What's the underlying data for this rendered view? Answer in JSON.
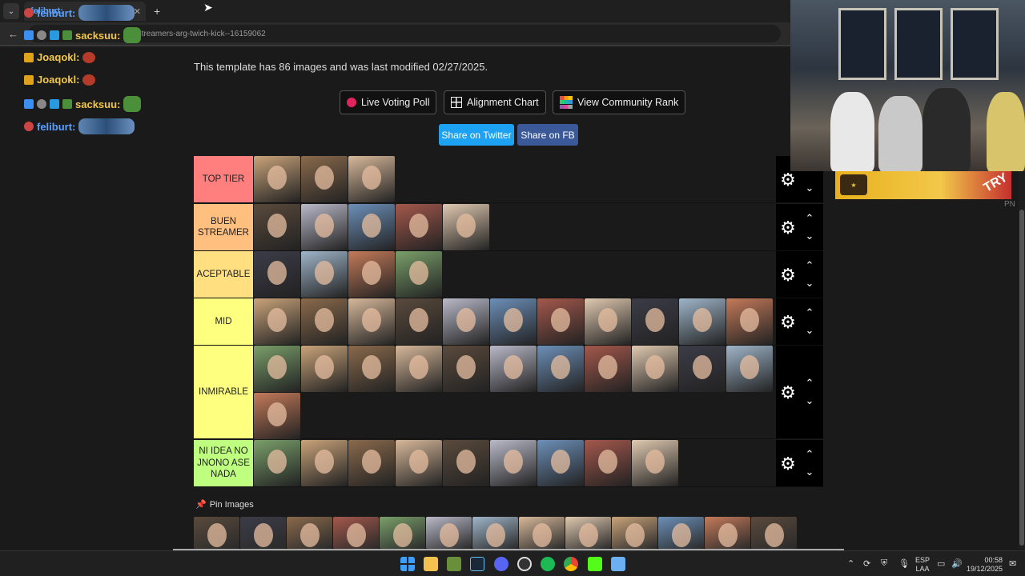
{
  "browser": {
    "tab_title": "feliburt:",
    "tab_close": "✕",
    "new_tab": "+",
    "url": "ate/streamers-arg-twich-kick--16159062",
    "back": "←"
  },
  "chat": [
    {
      "user": "feliburt:",
      "color": "#5aa0ff"
    },
    {
      "user": "sacksuu:",
      "color": "#f2c84a"
    },
    {
      "user": "Joaqokl:",
      "color": "#f2c84a"
    },
    {
      "user": "Joaqokl:",
      "color": "#f2c84a"
    },
    {
      "user": "sacksuu:",
      "color": "#f2c84a"
    },
    {
      "user": "feliburt:",
      "color": "#5aa0ff"
    }
  ],
  "page": {
    "info": "This template has 86 images and was last modified 02/27/2025.",
    "buttons": {
      "live_voting": "Live Voting Poll",
      "alignment": "Alignment Chart",
      "community": "View Community Rank",
      "share_twitter": "Share on Twitter",
      "share_fb": "Share on FB"
    },
    "pin_images": "Pin Images"
  },
  "tiers": [
    {
      "label": "TOP TIER",
      "color": "#ff7f7f",
      "count": 3
    },
    {
      "label": "BUEN STREAMER",
      "color": "#ffbf7f",
      "count": 5
    },
    {
      "label": "ACEPTABLE",
      "color": "#ffdf7f",
      "count": 4
    },
    {
      "label": "MID",
      "color": "#ffff7f",
      "count": 11
    },
    {
      "label": "INMIRABLE",
      "color": "#ffff7f",
      "count": 12
    },
    {
      "label": "NI IDEA NO JNONO ASE NADA",
      "color": "#bfff7f",
      "count": 9
    }
  ],
  "controls": {
    "gear": "⚙",
    "up": "⌃",
    "down": "⌄"
  },
  "ad": {
    "try": "TRY"
  },
  "side": {
    "pn": "PN"
  },
  "taskbar": {
    "lang_top": "ESP",
    "lang_bottom": "LAA",
    "time": "00:58",
    "date": "19/12/2025"
  }
}
